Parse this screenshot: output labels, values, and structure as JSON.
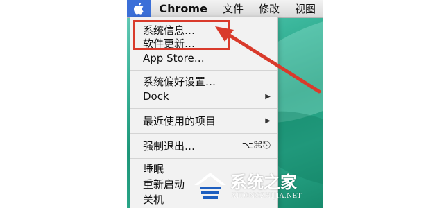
{
  "menubar": {
    "apple_icon": "apple-logo-icon",
    "app_name": "Chrome",
    "items": [
      "文件",
      "修改",
      "视图"
    ]
  },
  "apple_menu": {
    "items": [
      {
        "label": "系统信息…",
        "shortcut": "",
        "submenu": false
      },
      {
        "label": "软件更新…",
        "shortcut": "",
        "submenu": false
      },
      {
        "label": "App Store…",
        "shortcut": "",
        "submenu": false
      },
      {
        "label": "系统偏好设置…",
        "shortcut": "",
        "submenu": false
      },
      {
        "label": "Dock",
        "shortcut": "",
        "submenu": true
      },
      {
        "label": "最近使用的项目",
        "shortcut": "",
        "submenu": true
      },
      {
        "label": "强制退出…",
        "shortcut": "⌥⌘⎋",
        "submenu": false
      },
      {
        "label": "睡眠",
        "shortcut": "",
        "submenu": false
      },
      {
        "label": "重新启动",
        "shortcut": "",
        "submenu": false
      },
      {
        "label": "关机",
        "shortcut": "",
        "submenu": false
      }
    ],
    "submenu_arrow": "▶"
  },
  "annotation": {
    "box_color": "#d93a2b",
    "arrow_color": "#d93a2b"
  },
  "watermark": {
    "title": "系统之家",
    "subtitle": "XITONGZHIJIA.NET",
    "logo_icon": "house-logo-icon"
  },
  "colors": {
    "apple_highlight": "#3b6fd8",
    "menu_background": "#f2f2f2",
    "desktop_teal": "#2aa88a"
  }
}
